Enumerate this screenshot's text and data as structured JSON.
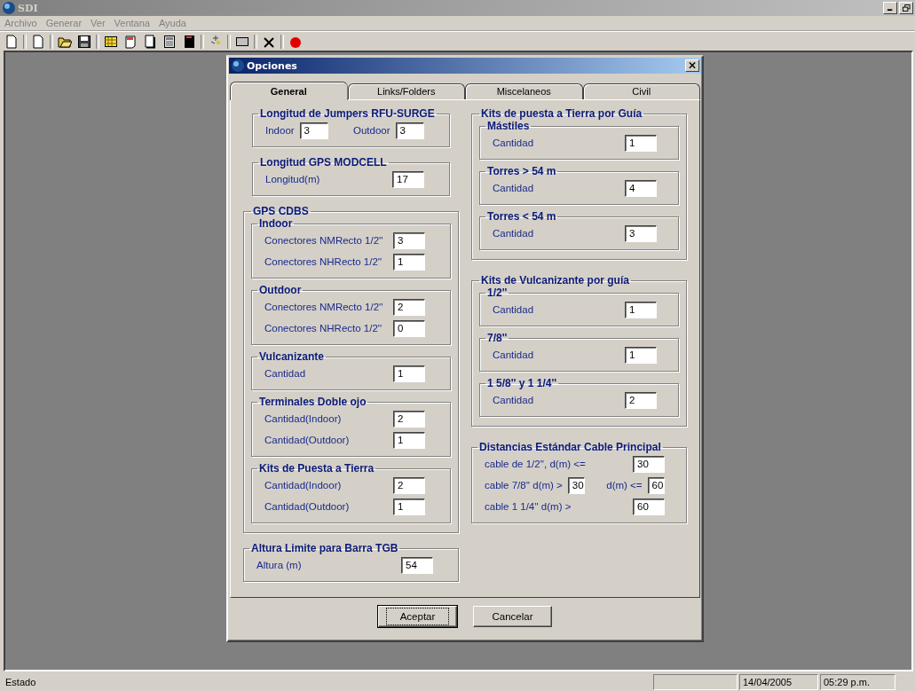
{
  "window": {
    "title": "SDI"
  },
  "menu": [
    {
      "label": "Archivo",
      "disabled": true
    },
    {
      "label": "Generar",
      "disabled": true
    },
    {
      "label": "Ver",
      "disabled": true
    },
    {
      "label": "Ventana",
      "disabled": true
    },
    {
      "label": "Ayuda",
      "disabled": true
    }
  ],
  "dialog": {
    "title": "Opciones",
    "tabs": [
      {
        "label": "General",
        "selected": true
      },
      {
        "label": "Links/Folders",
        "selected": false
      },
      {
        "label": "Miscelaneos",
        "selected": false
      },
      {
        "label": "Civil",
        "selected": false
      }
    ],
    "columns": [
      [
        {
          "title": "Longitud de Jumpers RFU-SURGE",
          "rows": [
            [
              {
                "kind": "label",
                "text": "Indoor"
              },
              {
                "kind": "field",
                "value": "3"
              },
              {
                "kind": "label",
                "text": "Outdoor"
              },
              {
                "kind": "field",
                "value": "3"
              }
            ]
          ]
        },
        {
          "title": "Longitud GPS MODCELL",
          "rows": [
            [
              {
                "kind": "label",
                "text": "Longitud(m)"
              },
              {
                "kind": "field",
                "value": "17"
              }
            ]
          ]
        },
        {
          "title": "GPS  CDBS",
          "groups": [
            {
              "title": "Indoor",
              "rows": [
                [
                  {
                    "kind": "label",
                    "text": "Conectores NMRecto 1/2''"
                  },
                  {
                    "kind": "field",
                    "value": "3"
                  }
                ],
                [
                  {
                    "kind": "label",
                    "text": "Conectores NHRecto 1/2''"
                  },
                  {
                    "kind": "field",
                    "value": "1"
                  }
                ]
              ]
            },
            {
              "title": "Outdoor",
              "rows": [
                [
                  {
                    "kind": "label",
                    "text": "Conectores NMRecto 1/2''"
                  },
                  {
                    "kind": "field",
                    "value": "2"
                  }
                ],
                [
                  {
                    "kind": "label",
                    "text": "Conectores NHRecto 1/2''"
                  },
                  {
                    "kind": "field",
                    "value": "0"
                  }
                ]
              ]
            },
            {
              "title": "Vulcanizante",
              "rows": [
                [
                  {
                    "kind": "label",
                    "text": "Cantidad"
                  },
                  {
                    "kind": "field",
                    "value": "1"
                  }
                ]
              ]
            },
            {
              "title": "Terminales Doble ojo",
              "rows": [
                [
                  {
                    "kind": "label",
                    "text": "Cantidad(Indoor)"
                  },
                  {
                    "kind": "field",
                    "value": "2"
                  }
                ],
                [
                  {
                    "kind": "label",
                    "text": "Cantidad(Outdoor)"
                  },
                  {
                    "kind": "field",
                    "value": "1"
                  }
                ]
              ]
            },
            {
              "title": "Kits de Puesta a Tierra",
              "rows": [
                [
                  {
                    "kind": "label",
                    "text": "Cantidad(Indoor)"
                  },
                  {
                    "kind": "field",
                    "value": "2"
                  }
                ],
                [
                  {
                    "kind": "label",
                    "text": "Cantidad(Outdoor)"
                  },
                  {
                    "kind": "field",
                    "value": "1"
                  }
                ]
              ]
            }
          ]
        },
        {
          "title": "Altura Limite para Barra TGB",
          "rows": [
            [
              {
                "kind": "label",
                "text": "Altura (m)"
              },
              {
                "kind": "field",
                "value": "54"
              }
            ]
          ]
        }
      ],
      [
        {
          "title": "Kits de puesta a Tierra por Guía",
          "groups": [
            {
              "title": "Mástiles",
              "rows": [
                [
                  {
                    "kind": "label",
                    "text": "Cantidad"
                  },
                  {
                    "kind": "field",
                    "value": "1"
                  }
                ]
              ]
            },
            {
              "title": "Torres > 54 m",
              "rows": [
                [
                  {
                    "kind": "label",
                    "text": "Cantidad"
                  },
                  {
                    "kind": "field",
                    "value": "4"
                  }
                ]
              ]
            },
            {
              "title": "Torres < 54 m",
              "rows": [
                [
                  {
                    "kind": "label",
                    "text": "Cantidad"
                  },
                  {
                    "kind": "field",
                    "value": "3"
                  }
                ]
              ]
            }
          ]
        },
        {
          "title": "Kits de Vulcanizante por guía",
          "groups": [
            {
              "title": "1/2''",
              "rows": [
                [
                  {
                    "kind": "label",
                    "text": "Cantidad"
                  },
                  {
                    "kind": "field",
                    "value": "1"
                  }
                ]
              ]
            },
            {
              "title": "7/8''",
              "rows": [
                [
                  {
                    "kind": "label",
                    "text": "Cantidad"
                  },
                  {
                    "kind": "field",
                    "value": "1"
                  }
                ]
              ]
            },
            {
              "title": "1 5/8'' y 1 1/4''",
              "rows": [
                [
                  {
                    "kind": "label",
                    "text": "Cantidad"
                  },
                  {
                    "kind": "field",
                    "value": "2"
                  }
                ]
              ]
            }
          ]
        },
        {
          "title": "Distancias Estándar Cable Principal",
          "rows": [
            [
              {
                "kind": "label",
                "text": "cable de 1/2'', d(m) <="
              },
              {
                "kind": "field",
                "value": "30"
              }
            ],
            [
              {
                "kind": "label",
                "text": "cable 7/8'' d(m) >"
              },
              {
                "kind": "field",
                "value": "30"
              },
              {
                "kind": "label",
                "text": "d(m) <="
              },
              {
                "kind": "field",
                "value": "60"
              }
            ],
            [
              {
                "kind": "label",
                "text": "cable 1 1/4'' d(m) >"
              },
              {
                "kind": "field",
                "value": "60"
              }
            ]
          ]
        }
      ]
    ],
    "buttons": [
      {
        "label": "Aceptar",
        "default": true
      },
      {
        "label": "Cancelar",
        "default": false
      }
    ]
  },
  "status_bar": {
    "text": "Estado",
    "date": "14/04/2005",
    "time": "05:29 p.m."
  }
}
